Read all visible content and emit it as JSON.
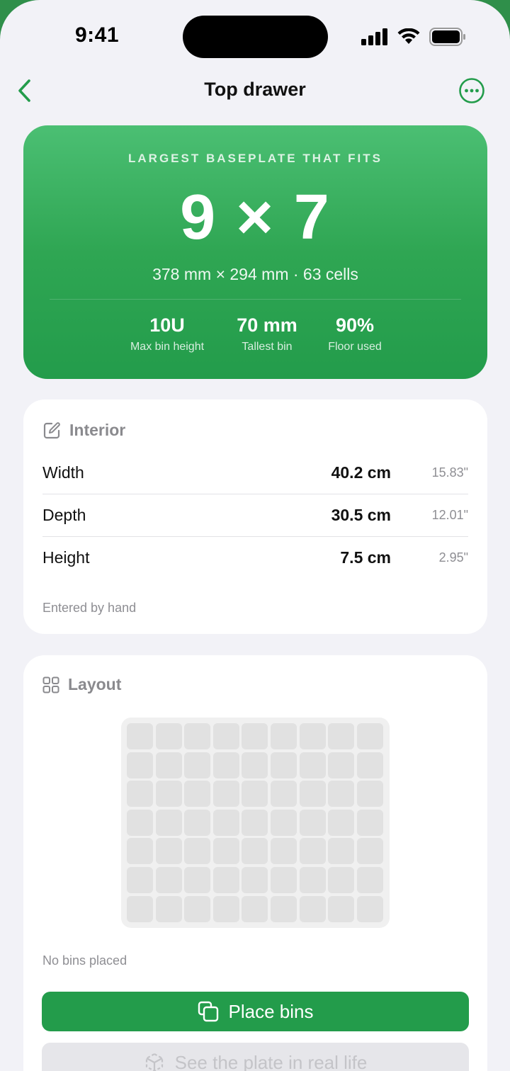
{
  "status": {
    "time": "9:41"
  },
  "nav": {
    "title": "Top drawer"
  },
  "hero": {
    "label": "LARGEST BASEPLATE THAT FITS",
    "size": "9 × 7",
    "summary": "378 mm × 294 mm · 63 cells",
    "stats": [
      {
        "value": "10U",
        "label": "Max bin height"
      },
      {
        "value": "70 mm",
        "label": "Tallest bin"
      },
      {
        "value": "90%",
        "label": "Floor used"
      }
    ]
  },
  "interior": {
    "title": "Interior",
    "rows": [
      {
        "label": "Width",
        "value": "40.2 cm",
        "inches": "15.83\""
      },
      {
        "label": "Depth",
        "value": "30.5 cm",
        "inches": "12.01\""
      },
      {
        "label": "Height",
        "value": "7.5 cm",
        "inches": "2.95\""
      }
    ],
    "note": "Entered by hand"
  },
  "layout": {
    "title": "Layout",
    "grid": {
      "columns": 9,
      "rows": 7
    },
    "note": "No bins placed",
    "primary_label": "Place bins",
    "secondary_label": "See the plate in real life"
  },
  "colors": {
    "accent": "#239c4b",
    "background": "#f2f2f7"
  }
}
